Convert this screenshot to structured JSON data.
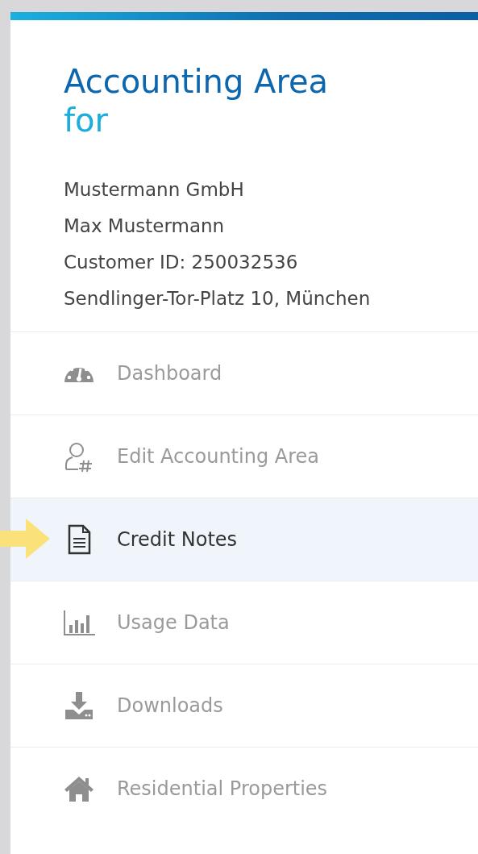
{
  "header": {
    "title": "Accounting Area",
    "subtitle": "for"
  },
  "customer": {
    "lines": [
      "Mustermann GmbH",
      "Max Mustermann",
      "Customer ID: 250032536",
      "Sendlinger-Tor-Platz 10, München"
    ]
  },
  "menu": {
    "items": [
      {
        "label": "Dashboard",
        "selected": false
      },
      {
        "label": "Edit Accounting Area",
        "selected": false
      },
      {
        "label": "Credit Notes",
        "selected": true
      },
      {
        "label": "Usage Data",
        "selected": false
      },
      {
        "label": "Downloads",
        "selected": false
      },
      {
        "label": "Residential Properties",
        "selected": false
      }
    ]
  }
}
